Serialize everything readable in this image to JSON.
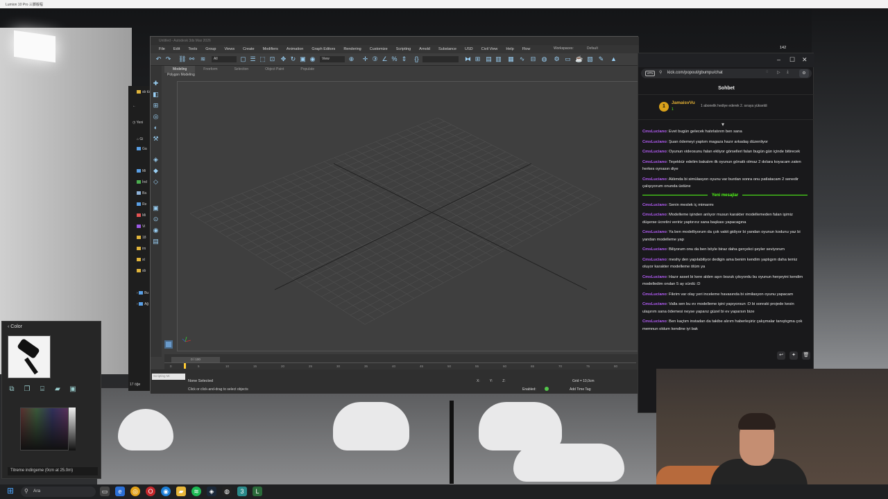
{
  "lumion": {
    "title": "Lumion 10 Pro 三脚版程",
    "color_panel": {
      "title": "Color",
      "status": "Titreme indirgeme (0cm at 25.0m)"
    },
    "items_count": "17 öğe"
  },
  "explorer": {
    "items": [
      "sb tü",
      "Yeni",
      "Gi",
      "Ga",
      "Mi",
      "İnd",
      "Ba",
      "Re",
      "Mi",
      "Vi",
      "18",
      "im",
      "st",
      "sb",
      "Bu",
      "Ağ"
    ]
  },
  "max": {
    "title": "Untitled - Autodesk 3ds Max 2026",
    "menu": [
      "File",
      "Edit",
      "Tools",
      "Group",
      "Views",
      "Create",
      "Modifiers",
      "Animation",
      "Graph Editors",
      "Rendering",
      "Customize",
      "Scripting",
      "Arnold",
      "Substance",
      "USD",
      "Civil View",
      "Help",
      "Flow"
    ],
    "workspaces_label": "Workspaces:",
    "workspaces_value": "Default",
    "selection_filter": "All",
    "view_dropdown": "View",
    "ribbon_tabs": [
      "Modeling",
      "Freeform",
      "Selection",
      "Object Paint",
      "Populate"
    ],
    "ribbon_sub": "Polygon Modeling",
    "time_slider": "0 / 100",
    "ruler_ticks": [
      "0",
      "5",
      "10",
      "15",
      "20",
      "25",
      "30",
      "35",
      "40",
      "45",
      "50",
      "55",
      "60",
      "65",
      "70",
      "75",
      "80"
    ],
    "maxscript_placeholder": "Scripting Mi",
    "status_selection": "None Selected",
    "status_prompt": "Click or click-and-drag to select objects",
    "coords": {
      "x": "X:",
      "y": "Y:",
      "z": "Z:"
    },
    "grid": "Grid = 10,0cm",
    "enabled": "Enabled:",
    "add_time_tag": "Add Time Tag",
    "counter": "142"
  },
  "chat": {
    "url": "kick.com/popout/gbumpu/chat",
    "vpn": "VPN",
    "header": "Sohbet",
    "pinned": {
      "user": "JamaisvVu",
      "count": "1",
      "text": "1 abonelik hediye ederek 2. sıraya yükseldi"
    },
    "new_messages_label": "Yeni mesajlar",
    "messages_before": [
      {
        "user": "CmsLuciano",
        "text": ": Evet bugün gelecek hatırlatırım ben sana"
      },
      {
        "user": "CmsLuciano",
        "text": ": Şuan ödemeyi yaptım magaza hazır arkadaş düzenliyor"
      },
      {
        "user": "CmsLuciano",
        "text": ": Oyunun videosunu falan ekliyor görselleri falan bugün gün içinde bitirecek"
      },
      {
        "user": "CmsLuciano",
        "text": ": Teşekkür edelim bakalım ilk oyunun gönatlı olmaz 2 dolara koyacam zaten herkes oynasın diye"
      },
      {
        "user": "CmsLuciano",
        "text": ": Aklımda bi simülasyon oyunu var burdan sonra onu patlatacam 2 senedir çalışıyorum onunda üstüne"
      }
    ],
    "messages_after": [
      {
        "user": "CmsLuciano",
        "text": ": Senin meslek iç mimarmı"
      },
      {
        "user": "CmsLuciano",
        "text": ": Modelleme işinden anlıyor musun karakter modellemeden falan işimiz düşerse ücretini veririz yaptırırız sana başkası yapacagına"
      },
      {
        "user": "CmsLuciano",
        "text": ": Ya ben modelliyorum da çok vakit gidiyor bi yandan oyunun kodunu yaz bi yandan modelleme yap"
      },
      {
        "user": "CmsLuciano",
        "text": ": Biliyorum onu da ben böyle biraz daha gerçekci şeyler seviyorum"
      },
      {
        "user": "CmsLuciano",
        "text": ": meshy den yapılabiliyor dedigin ama benim kendim yaptıgım daha temiz oluyor karakter modelleme ölüm ya"
      },
      {
        "user": "CmsLuciano",
        "text": ": Hazır asset bi kere aldım aşırı bozuk çıkıyordu bu oyunun herşeyini kendim modelledim ondan 5 ay sürdü :D"
      },
      {
        "user": "CmsLuciano",
        "text": ": Fikrim var olay yeri inceleme havasında bi similasyon oyunu yapacam"
      },
      {
        "user": "CmsLuciano",
        "text": ": Valla sen bu ev modelleme işini yapıyorsun :D bi sonraki projede kesin ulaşırım sana ödemesi neyse yaparız güzel bi ev yaparsın bize"
      },
      {
        "user": "CmsLuciano",
        "text": ": Ben kaçtım instadan da takibe alırım haberleşiriz çalışmalar tanıştıgma çok memnun oldum kendine iyi bak"
      }
    ]
  },
  "taskbar": {
    "search": "Ara"
  },
  "colors": {
    "kick_green": "#53fc18",
    "chat_user": "#b45df7",
    "pinned_gold": "#e9b434",
    "max_accent": "#9ad0f5"
  }
}
